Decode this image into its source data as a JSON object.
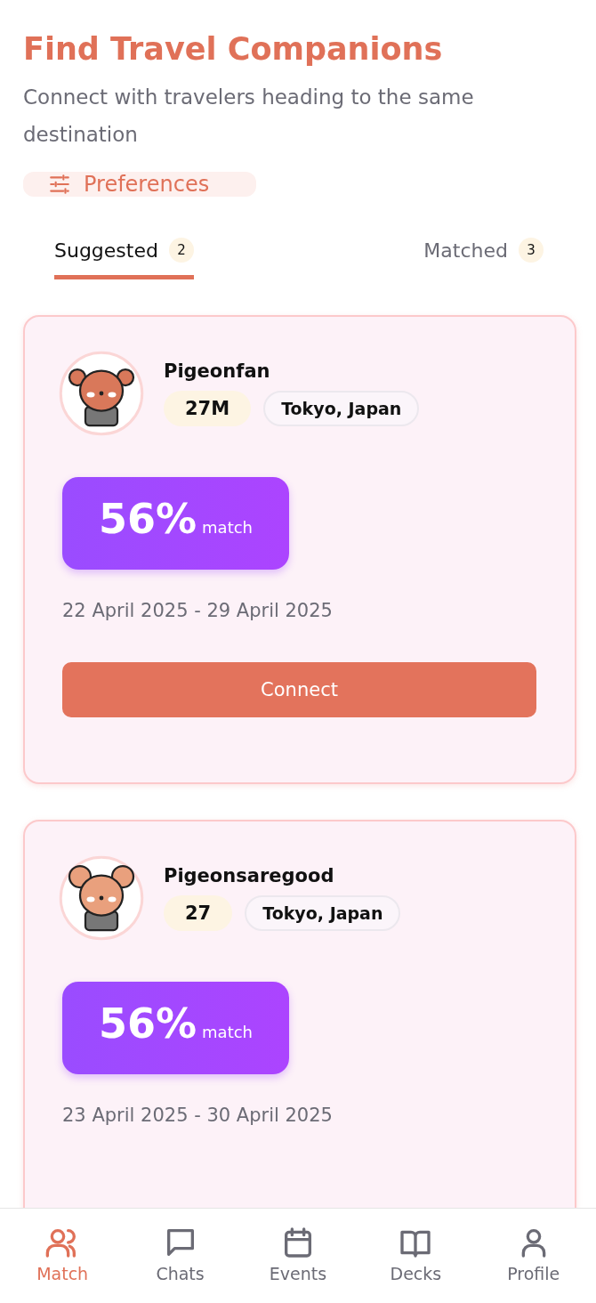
{
  "header": {
    "title": "Find Travel Companions",
    "subtitle": "Connect with travelers heading to the same destination"
  },
  "preferences_button": {
    "label": "Preferences"
  },
  "tabs": [
    {
      "label": "Suggested",
      "count": "2",
      "selected": true
    },
    {
      "label": "Matched",
      "count": "3",
      "selected": false
    }
  ],
  "cards": [
    {
      "username": "Pigeonfan",
      "age": "27M",
      "location": "Tokyo, Japan",
      "match_percent": "56%",
      "match_label": "match",
      "dates": "22 April 2025 - 29 April 2025",
      "connect_button": "Connect"
    },
    {
      "username": "Pigeonsaregood",
      "age": "27",
      "location": "Tokyo, Japan",
      "match_percent": "56%",
      "match_label": "match",
      "dates": "23 April 2025 - 30 April 2025"
    }
  ],
  "bottom_nav": [
    {
      "label": "Match",
      "selected": true
    },
    {
      "label": "Chats",
      "selected": false
    },
    {
      "label": "Events",
      "selected": false
    },
    {
      "label": "Decks",
      "selected": false
    },
    {
      "label": "Profile",
      "selected": false
    }
  ]
}
